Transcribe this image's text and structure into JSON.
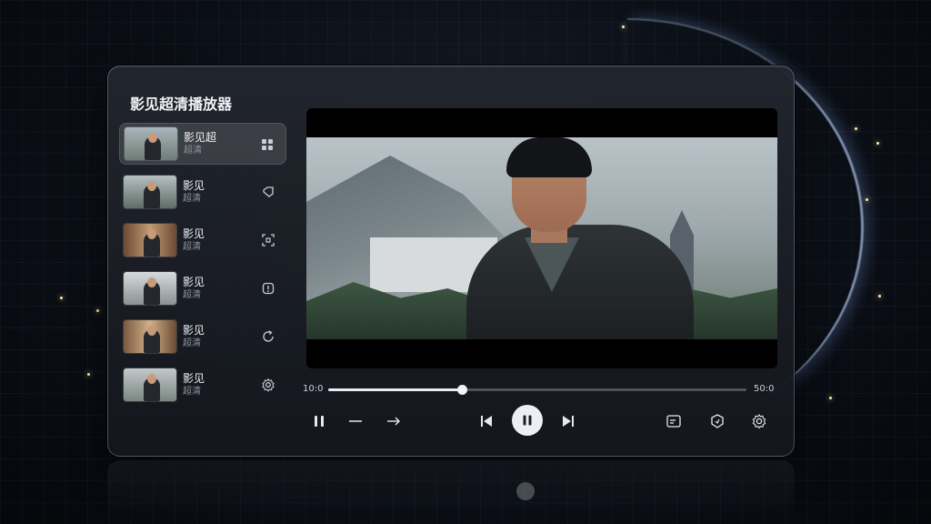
{
  "app": {
    "title": "影见超清播放器"
  },
  "sidebar": {
    "items": [
      {
        "title": "影见超",
        "subtitle": "超清",
        "icon": "grid-icon",
        "active": true
      },
      {
        "title": "影见",
        "subtitle": "超清",
        "icon": "tag-icon",
        "active": false
      },
      {
        "title": "影见",
        "subtitle": "超清",
        "icon": "scan-icon",
        "active": false
      },
      {
        "title": "影见",
        "subtitle": "超清",
        "icon": "alert-icon",
        "active": false
      },
      {
        "title": "影见",
        "subtitle": "超清",
        "icon": "refresh-icon",
        "active": false
      },
      {
        "title": "影见",
        "subtitle": "超清",
        "icon": "gear-icon",
        "active": false
      }
    ]
  },
  "player": {
    "current_time": "10:0",
    "total_time": "50:0",
    "progress": 0.32
  },
  "controls": {
    "left": [
      "pause-icon",
      "minus-icon",
      "forward-arrow-icon"
    ],
    "center": [
      "previous-icon",
      "pause-main-icon",
      "next-icon"
    ],
    "right": [
      "subtitle-icon",
      "shield-icon",
      "gear-icon"
    ]
  },
  "colors": {
    "accent": "#e9edf2",
    "panel": "#1e2229",
    "glow": "#bcd4ff"
  }
}
